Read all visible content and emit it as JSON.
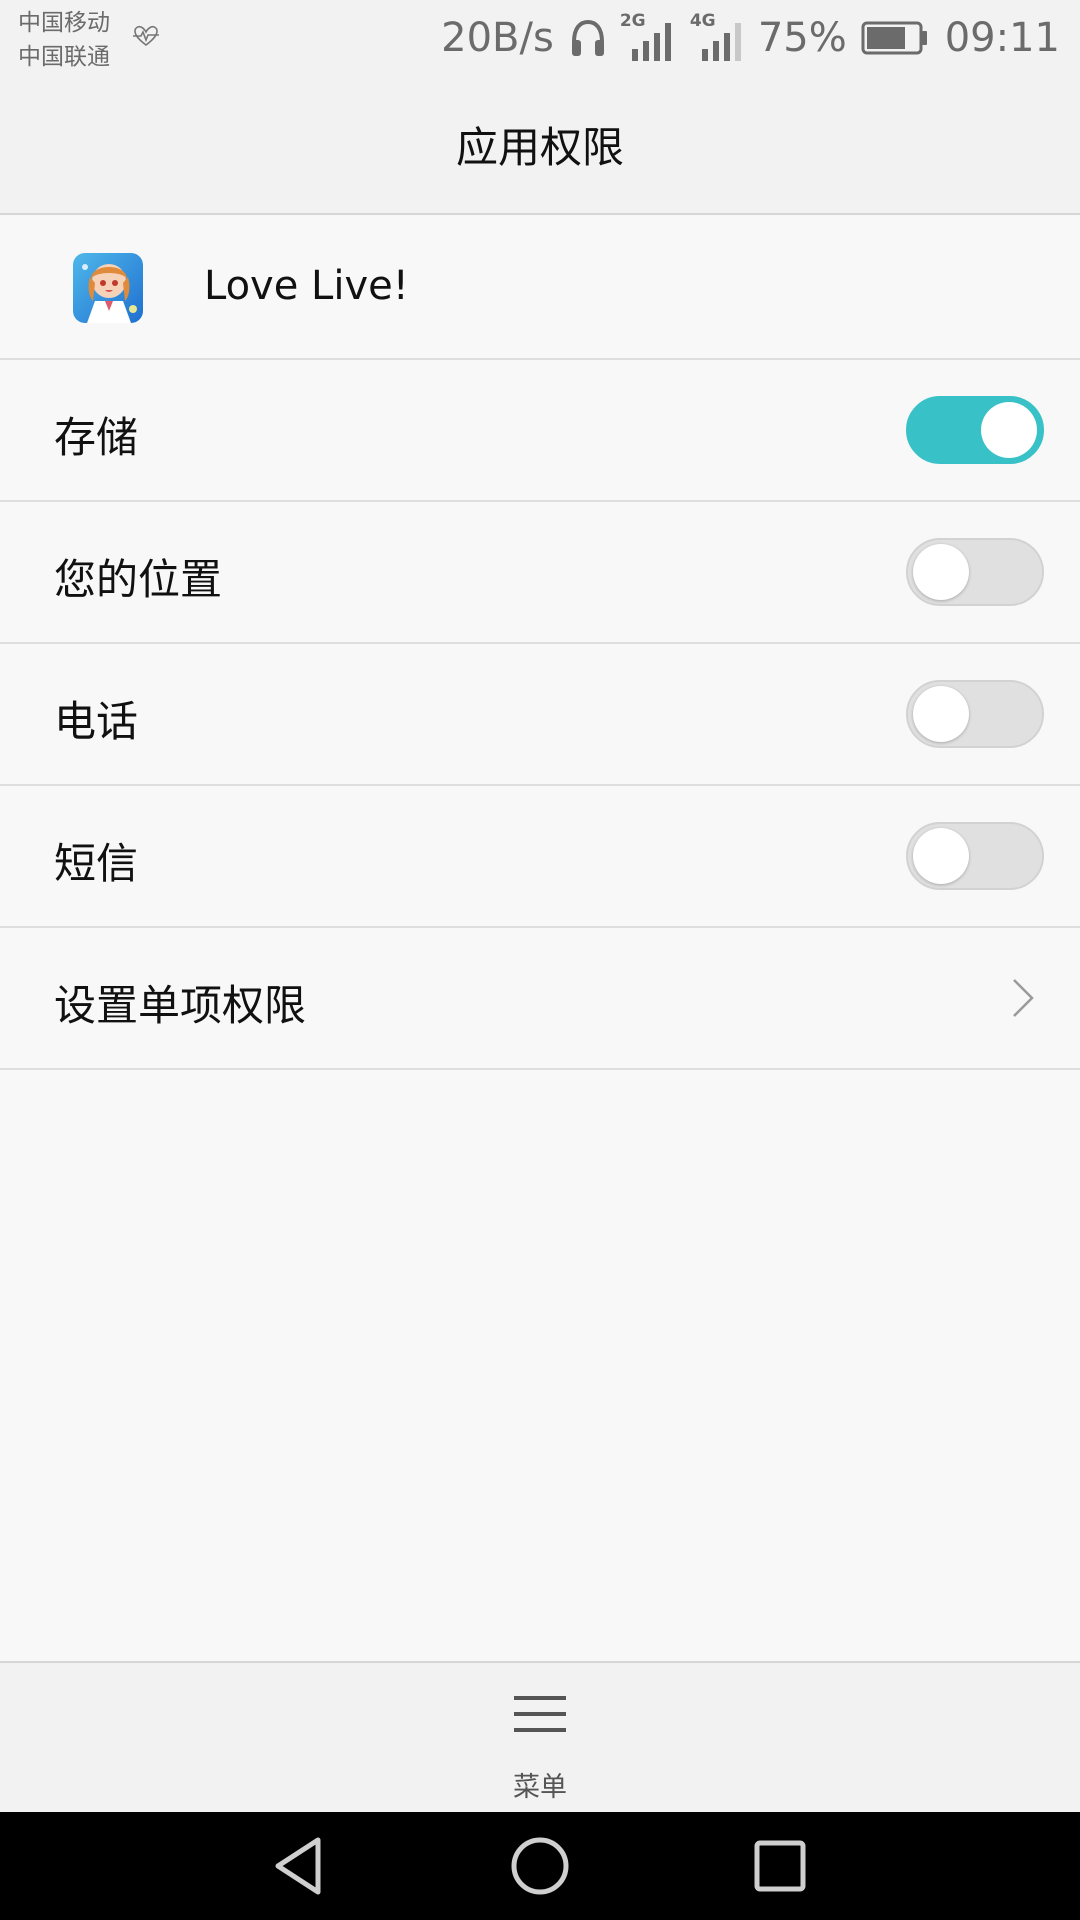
{
  "status_bar": {
    "carrier_1": "中国移动",
    "carrier_2": "中国联通",
    "net_speed": "20B/s",
    "signal_1_label": "2G",
    "signal_2_label": "4G",
    "battery_percent": "75%",
    "battery_level": 0.75,
    "time": "09:11"
  },
  "header": {
    "title": "应用权限"
  },
  "app": {
    "name": "Love Live!",
    "icon": "app-icon-love-live"
  },
  "permissions": [
    {
      "label": "存储",
      "enabled": true
    },
    {
      "label": "您的位置",
      "enabled": false
    },
    {
      "label": "电话",
      "enabled": false
    },
    {
      "label": "短信",
      "enabled": false
    }
  ],
  "individual_permissions": {
    "label": "设置单项权限",
    "icon": "chevron-right-icon"
  },
  "bottom_menu": {
    "label": "菜单",
    "icon": "menu-icon"
  },
  "nav": {
    "back": "back-icon",
    "home": "home-icon",
    "recent": "recent-apps-icon"
  },
  "colors": {
    "accent": "#38c1c6",
    "toggle_off": "#e0e0e0",
    "background": "#f8f8f8",
    "bar": "#f2f2f2"
  }
}
